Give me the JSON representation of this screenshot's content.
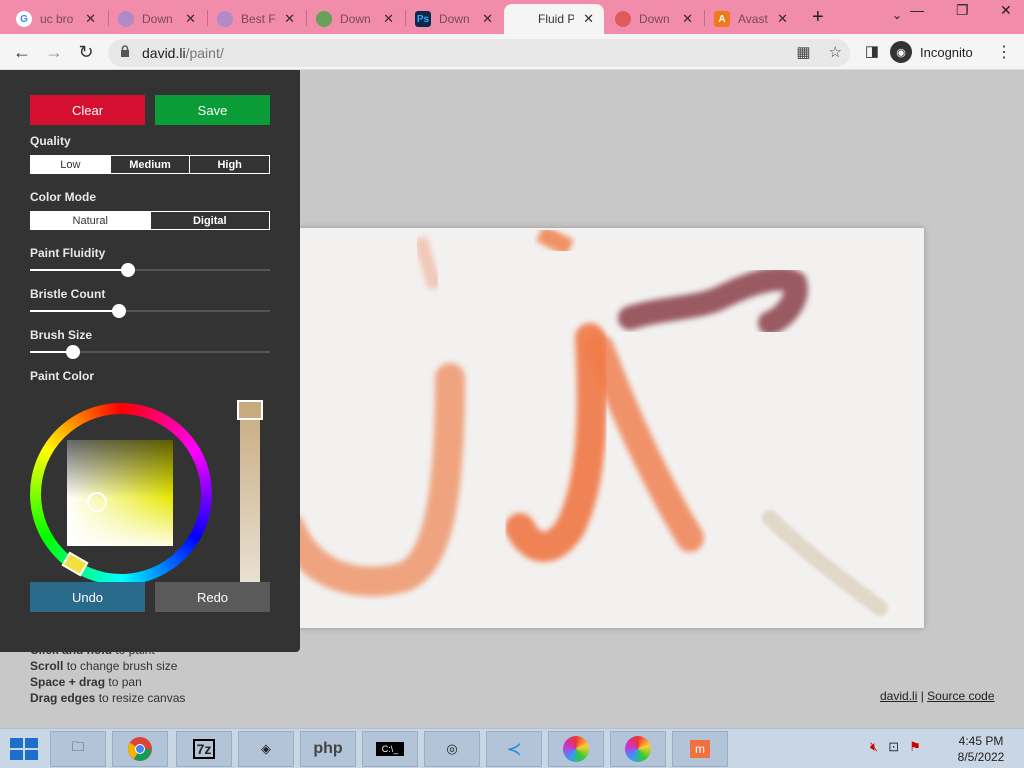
{
  "tabs": [
    {
      "title": "uc bro",
      "favicon": "google-icon",
      "active": false
    },
    {
      "title": "Down",
      "favicon": "page-icon",
      "active": false
    },
    {
      "title": "Best F",
      "favicon": "page-icon",
      "active": false
    },
    {
      "title": "Down",
      "favicon": "download-icon",
      "active": false
    },
    {
      "title": "Down",
      "favicon": "photoshop-icon",
      "active": false
    },
    {
      "title": "Fluid P",
      "favicon": "",
      "active": true
    },
    {
      "title": "Down",
      "favicon": "download-icon",
      "active": false
    },
    {
      "title": "Avast",
      "favicon": "avast-icon",
      "active": false
    }
  ],
  "browser": {
    "url_host": "david.li",
    "url_path": "/paint/",
    "incognito_label": "Incognito"
  },
  "panel": {
    "clear_label": "Clear",
    "save_label": "Save",
    "quality_label": "Quality",
    "quality_options": [
      "Low",
      "Medium",
      "High"
    ],
    "quality_selected": "Low",
    "color_mode_label": "Color Mode",
    "color_mode_options": [
      "Natural",
      "Digital"
    ],
    "color_mode_selected": "Natural",
    "fluidity_label": "Paint Fluidity",
    "fluidity_value": 0.41,
    "bristle_label": "Bristle Count",
    "bristle_value": 0.37,
    "brush_label": "Brush Size",
    "brush_value": 0.18,
    "paint_color_label": "Paint Color",
    "undo_label": "Undo",
    "redo_label": "Redo"
  },
  "tips": [
    {
      "bold": "Click and hold",
      "rest": " to paint"
    },
    {
      "bold": "Scroll",
      "rest": " to change brush size"
    },
    {
      "bold": "Space + drag",
      "rest": " to pan"
    },
    {
      "bold": "Drag edges",
      "rest": " to resize canvas"
    }
  ],
  "footer": {
    "link1": "david.li",
    "sep": " | ",
    "link2": "Source code"
  },
  "taskbar": {
    "items": [
      "file-explorer-icon",
      "chrome-icon",
      "7zip-icon",
      "app-icon",
      "php-icon",
      "cmd-icon",
      "media-icon",
      "vscode-icon",
      "color-wheel-icon",
      "color-wheel-icon",
      "app-icon"
    ],
    "clock_time": "4:45 PM",
    "clock_date": "8/5/2022"
  },
  "colors": {
    "clear_button": "#d50f30",
    "save_button": "#0a9c37",
    "undo_button": "#2a6a8a",
    "redo_button": "#5a5a5a",
    "tabstrip": "#f28cab",
    "paint_color": "#c8ab7c"
  }
}
